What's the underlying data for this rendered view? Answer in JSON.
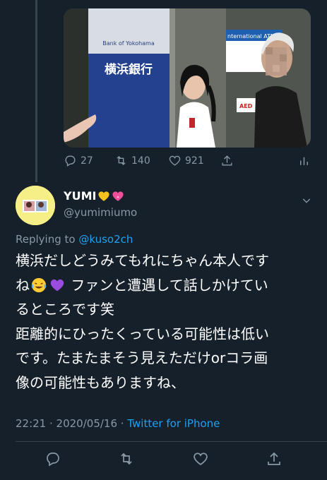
{
  "quoted_tweet": {
    "photo_signs": {
      "bank_small": "Bank of Yokohama",
      "bank_big": "横浜銀行",
      "atm": "nternational ATM",
      "aed": "AED"
    },
    "actions": {
      "reply_count": "27",
      "retweet_count": "140",
      "like_count": "921"
    }
  },
  "tweet": {
    "display_name": "YUMI",
    "name_emojis": [
      "yellow-heart",
      "sparkling-heart"
    ],
    "handle": "@yumimiumo",
    "reply_prefix": "Replying to ",
    "reply_to": "@kuso2ch",
    "text_part1": "横浜だしどうみてもれにちゃん本人です\nね",
    "text_part2": " ファンと遭遇して話しかけてい\nるところです笑\n距離的にひったくっている可能性は低い\nです。たまたまそう見えただけorコラ画\n像の可能性もありますね、",
    "emojis_inline": [
      "laughing-crying-emoji",
      "purple-heart-emoji"
    ],
    "time": "22:21",
    "date": "2020/05/16",
    "separator": " · ",
    "source": "Twitter for iPhone"
  },
  "colors": {
    "background": "#15202b",
    "secondary_text": "#8899a6",
    "link": "#1da1f2",
    "divider": "#38444d"
  }
}
